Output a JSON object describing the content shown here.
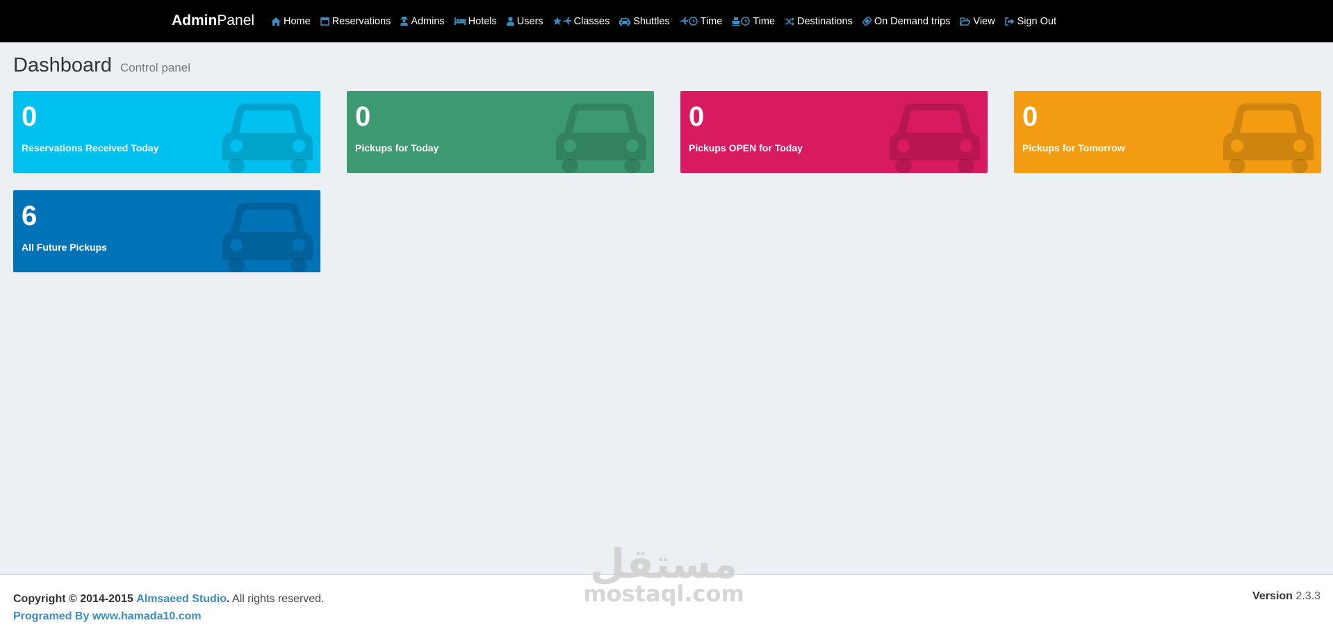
{
  "navbar": {
    "brand_bold": "Admin",
    "brand_regular": "Panel",
    "items": [
      {
        "label": "Home",
        "icon": "home-icon"
      },
      {
        "label": "Reservations",
        "icon": "calendar-icon"
      },
      {
        "label": "Admins",
        "icon": "user-secret-icon"
      },
      {
        "label": "Hotels",
        "icon": "bed-icon"
      },
      {
        "label": "Users",
        "icon": "user-icon"
      },
      {
        "label": "Classes",
        "icon": "star-plane-icon"
      },
      {
        "label": "Shuttles",
        "icon": "car-icon"
      },
      {
        "label": "Time",
        "icon": "plane-clock-icon"
      },
      {
        "label": "Time",
        "icon": "ship-clock-icon"
      },
      {
        "label": "Destinations",
        "icon": "random-icon"
      },
      {
        "label": "On Demand trips",
        "icon": "ticket-icon"
      },
      {
        "label": "View",
        "icon": "folder-open-icon"
      },
      {
        "label": "Sign Out",
        "icon": "sign-out-icon"
      }
    ]
  },
  "header": {
    "title": "Dashboard",
    "subtitle": "Control panel"
  },
  "boxes": [
    {
      "value": "0",
      "label": "Reservations Received Today",
      "color": "#00c0ef"
    },
    {
      "value": "0",
      "label": "Pickups for Today",
      "color": "#3d9970"
    },
    {
      "value": "0",
      "label": "Pickups OPEN for Today",
      "color": "#d81b60"
    },
    {
      "value": "0",
      "label": "Pickups for Tomorrow",
      "color": "#f39c12"
    },
    {
      "value": "6",
      "label": "All Future Pickups",
      "color": "#0073b7"
    }
  ],
  "footer": {
    "copyright_prefix": "Copyright © 2014-2015",
    "studio_link": "Almsaeed Studio",
    "period": ".",
    "rights": "All rights reserved.",
    "programmed_by": "Programed By www.hamada10.com",
    "version_label": "Version",
    "version_value": "2.3.3"
  },
  "watermark": {
    "arabic": "مستقل",
    "latin": "mostaql.com"
  }
}
